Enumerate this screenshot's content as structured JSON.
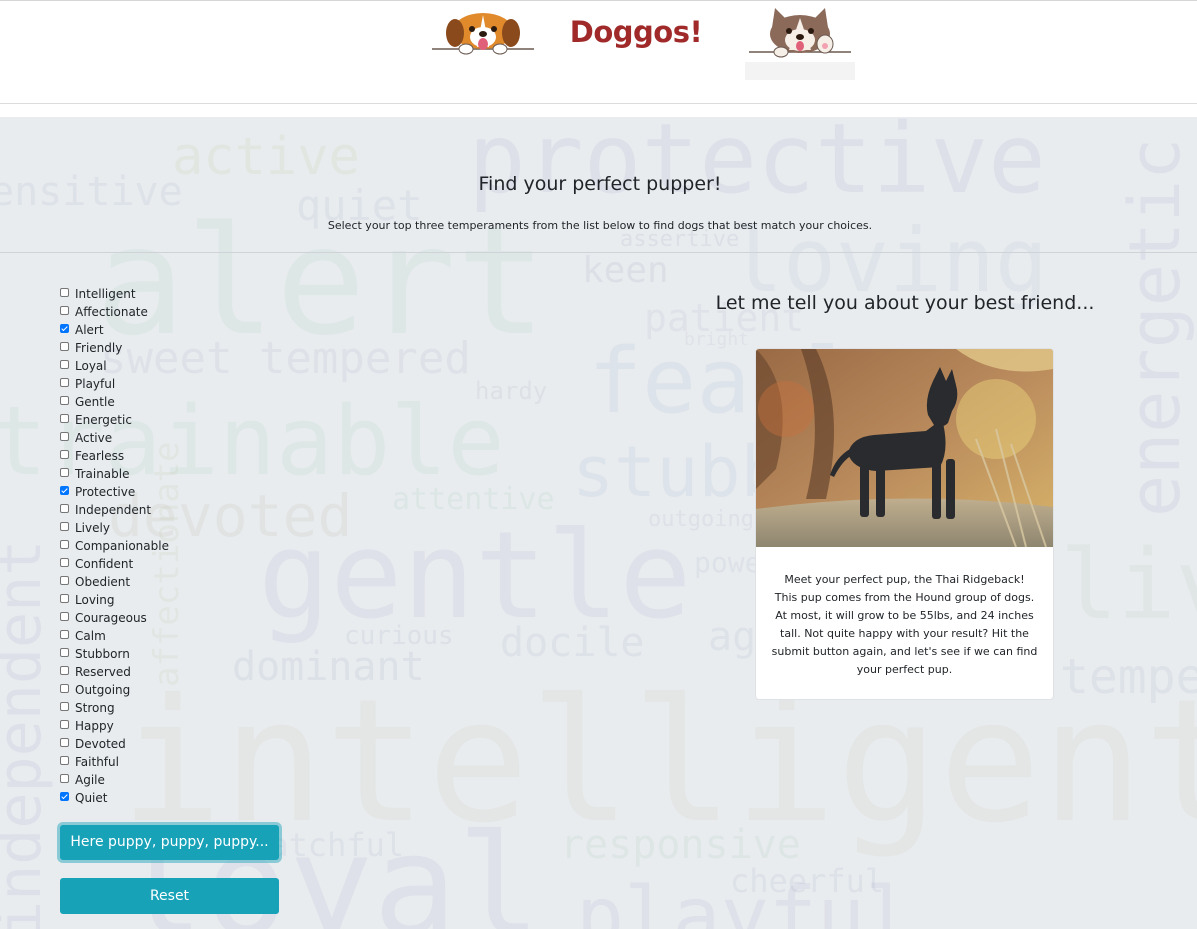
{
  "header": {
    "title": "Doggos!"
  },
  "hero": {
    "heading": "Find your perfect pupper!",
    "subheading": "Select your top three temperaments from the list below to find dogs that best match your choices."
  },
  "temperaments": [
    {
      "label": "Intelligent",
      "checked": false
    },
    {
      "label": "Affectionate",
      "checked": false
    },
    {
      "label": "Alert",
      "checked": true
    },
    {
      "label": "Friendly",
      "checked": false
    },
    {
      "label": "Loyal",
      "checked": false
    },
    {
      "label": "Playful",
      "checked": false
    },
    {
      "label": "Gentle",
      "checked": false
    },
    {
      "label": "Energetic",
      "checked": false
    },
    {
      "label": "Active",
      "checked": false
    },
    {
      "label": "Fearless",
      "checked": false
    },
    {
      "label": "Trainable",
      "checked": false
    },
    {
      "label": "Protective",
      "checked": true
    },
    {
      "label": "Independent",
      "checked": false
    },
    {
      "label": "Lively",
      "checked": false
    },
    {
      "label": "Companionable",
      "checked": false
    },
    {
      "label": "Confident",
      "checked": false
    },
    {
      "label": "Obedient",
      "checked": false
    },
    {
      "label": "Loving",
      "checked": false
    },
    {
      "label": "Courageous",
      "checked": false
    },
    {
      "label": "Calm",
      "checked": false
    },
    {
      "label": "Stubborn",
      "checked": false
    },
    {
      "label": "Reserved",
      "checked": false
    },
    {
      "label": "Outgoing",
      "checked": false
    },
    {
      "label": "Strong",
      "checked": false
    },
    {
      "label": "Happy",
      "checked": false
    },
    {
      "label": "Devoted",
      "checked": false
    },
    {
      "label": "Faithful",
      "checked": false
    },
    {
      "label": "Agile",
      "checked": false
    },
    {
      "label": "Quiet",
      "checked": true
    }
  ],
  "buttons": {
    "submit": "Here puppy, puppy, puppy...",
    "reset": "Reset"
  },
  "result": {
    "title": "Let me tell you about your best friend...",
    "line1": "Meet your perfect pup, the Thai Ridgeback!",
    "body": "This pup comes from the Hound group of dogs. At most, it will grow to be 55lbs, and 24 inches tall. Not quite happy with your result? Hit the submit button again, and let's see if we can find your perfect pup."
  },
  "word_cloud": [
    "protective",
    "active",
    "ensitive",
    "quiet",
    "alert",
    "loving",
    "keen",
    "assertive",
    "sweet tempered",
    "patient",
    "bright",
    "fearless",
    "hardy",
    "trainable",
    "stubborn",
    "attentive",
    "devoted",
    "outgoing",
    "gentle",
    "powerful",
    "lively",
    "curious",
    "docile",
    "dominant",
    "agile",
    "intelligent",
    "loyal",
    "responsive",
    "cheerful",
    "playful",
    "tempered",
    "energetic",
    "independent",
    "watchful",
    "affectionate"
  ],
  "colors": {
    "title": "#a02a2a",
    "button": "#17a2b8",
    "background": "#e9ecef",
    "checkbox": "#0075ff"
  }
}
